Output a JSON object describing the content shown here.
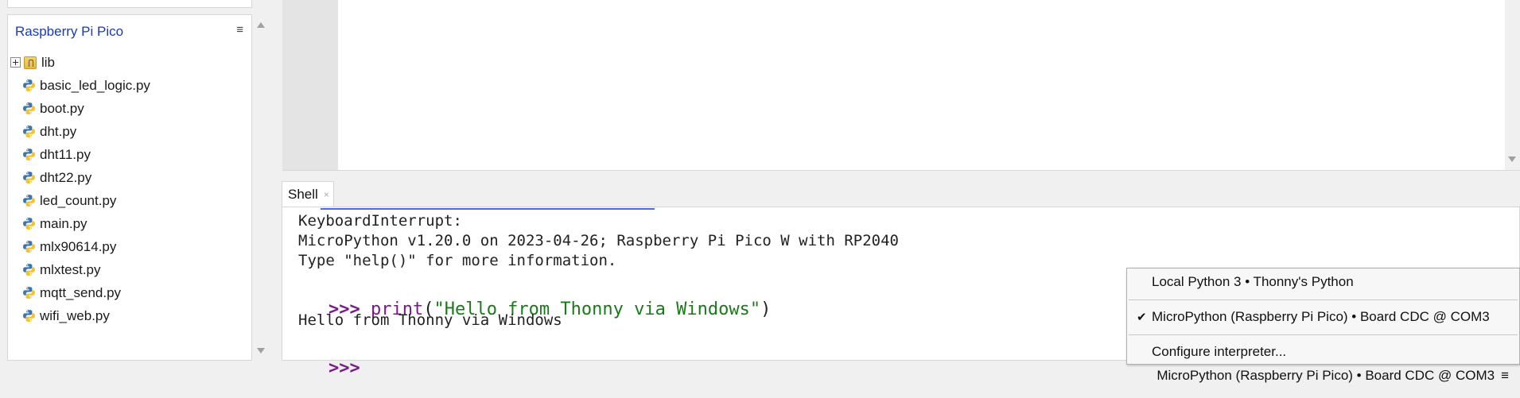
{
  "files": {
    "title": "Raspberry Pi Pico",
    "menu_icon": "≡",
    "items": [
      {
        "name": "lib",
        "type": "folder"
      },
      {
        "name": "basic_led_logic.py",
        "type": "python"
      },
      {
        "name": "boot.py",
        "type": "python"
      },
      {
        "name": "dht.py",
        "type": "python"
      },
      {
        "name": "dht11.py",
        "type": "python"
      },
      {
        "name": "dht22.py",
        "type": "python"
      },
      {
        "name": "led_count.py",
        "type": "python"
      },
      {
        "name": "main.py",
        "type": "python"
      },
      {
        "name": "mlx90614.py",
        "type": "python"
      },
      {
        "name": "mlxtest.py",
        "type": "python"
      },
      {
        "name": "mqtt_send.py",
        "type": "python"
      },
      {
        "name": "wifi_web.py",
        "type": "python"
      }
    ]
  },
  "shell": {
    "tab_label": "Shell",
    "tab_close": "×",
    "lines": [
      "KeyboardInterrupt:",
      "MicroPython v1.20.0 on 2023-04-26; Raspberry Pi Pico W with RP2040",
      "Type \"help()\" for more information."
    ],
    "prompt": ">>>",
    "command": {
      "fn": "print",
      "open": "(",
      "string": "\"Hello from Thonny via Windows\"",
      "close": ")"
    },
    "output": "Hello from Thonny via Windows",
    "empty_prompt": ">>>"
  },
  "interpreter_menu": {
    "items": [
      {
        "label": "Local Python 3  •  Thonny's Python",
        "checked": false
      },
      {
        "label": "MicroPython (Raspberry Pi Pico)  •  Board CDC @ COM3",
        "checked": true
      },
      {
        "label": "Configure interpreter...",
        "checked": false
      }
    ],
    "check_mark": "✔"
  },
  "statusbar": {
    "interpreter": "MicroPython (Raspberry Pi Pico)  •  Board CDC @ COM3",
    "menu_icon": "≡"
  },
  "colors": {
    "files_title": "#1a3ab8",
    "prompt": "#7a1a8a",
    "string": "#1a7a1a"
  }
}
